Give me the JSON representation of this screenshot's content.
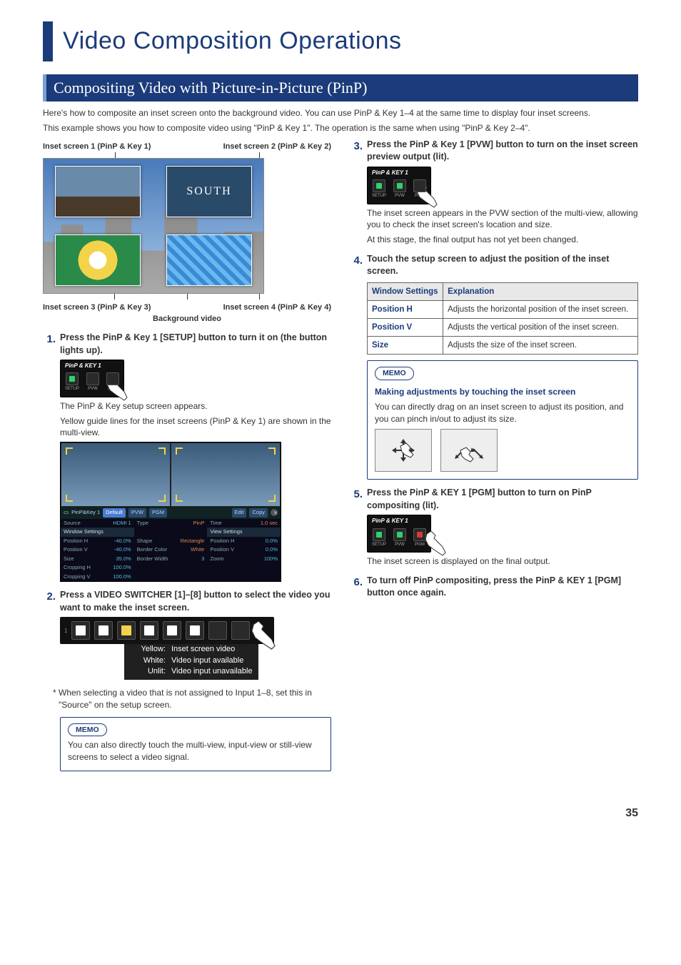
{
  "chapter_title": "Video Composition Operations",
  "section_title": "Compositing Video with Picture-in-Picture (PinP)",
  "intro": {
    "l1": "Here's how to composite an inset screen onto the background video. You can use PinP & Key 1–4 at the same time to display four inset screens.",
    "l2": "This example shows you how to composite video using \"PinP & Key 1\". The operation is the same when using \"PinP & Key 2–4\"."
  },
  "fig_labels": {
    "tl": "Inset screen 1 (PinP & Key 1)",
    "tr": "Inset screen 2 (PinP & Key 2)",
    "bl": "Inset screen 3 (PinP & Key 3)",
    "br": "Inset screen 4 (PinP & Key 4)",
    "bg": "Background video",
    "south": "SOUTH"
  },
  "steps": {
    "s1": {
      "num": "1.",
      "text": "Press the PinP & Key 1 [SETUP] button to turn it on (the button lights up).",
      "after": "The PinP & Key setup screen appears.",
      "after2": "Yellow guide lines for the inset screens (PinP & Key 1) are shown in the multi-view."
    },
    "s2": {
      "num": "2.",
      "text": "Press a VIDEO SWITCHER [1]–[8] button to select the video you want to make the inset screen.",
      "legend": {
        "yellow_k": "Yellow:",
        "yellow_v": "Inset screen video",
        "white_k": "White:",
        "white_v": "Video input available",
        "unlit_k": "Unlit:",
        "unlit_v": "Video input unavailable"
      },
      "footnote": "*  When selecting a video that is not assigned to Input 1–8, set this in \"Source\" on the setup screen."
    },
    "memo1": {
      "pill": "MEMO",
      "body": "You can also directly touch the multi-view, input-view or still-view screens to select a video signal."
    },
    "s3": {
      "num": "3.",
      "text": "Press the PinP & Key 1 [PVW] button to turn on the inset screen preview output (lit).",
      "after": "The inset screen appears in the PVW section of the multi-view, allowing you to check the inset screen's location and size.",
      "after2": "At this stage, the final output has not yet been changed."
    },
    "s4": {
      "num": "4.",
      "text": "Touch the setup screen to adjust the position of the inset screen."
    },
    "memo2": {
      "pill": "MEMO",
      "title": "Making adjustments by touching the inset screen",
      "body": "You can directly drag on an inset screen to adjust its position, and you can pinch in/out to adjust its size."
    },
    "s5": {
      "num": "5.",
      "text": "Press the PinP & KEY 1 [PGM] button to turn on PinP compositing (lit).",
      "after": "The inset screen is displayed on the final output."
    },
    "s6": {
      "num": "6.",
      "text": "To turn off PinP compositing, press the PinP & KEY 1 [PGM] button once again."
    }
  },
  "panel": {
    "title": "PinP & KEY 1",
    "l1": "SETUP",
    "l2": "PVW",
    "l3": "PGM"
  },
  "setup_screen": {
    "name": "PinP&Key 1",
    "default": "Default",
    "pvw": "PVW",
    "pgm": "PGM",
    "edit": "Edit",
    "copy": "Copy",
    "rows_left": [
      {
        "k": "Source",
        "v": "HDMI 1"
      },
      {
        "k": "Window Settings",
        "v": ""
      },
      {
        "k": "Position H",
        "v": "-40.0%"
      },
      {
        "k": "Position V",
        "v": "-40.0%"
      },
      {
        "k": "Size",
        "v": "35.0%"
      },
      {
        "k": "Cropping H",
        "v": "100.0%"
      },
      {
        "k": "Cropping V",
        "v": "100.0%"
      }
    ],
    "rows_mid": [
      {
        "k": "Type",
        "v": "PinP"
      },
      {
        "k": "",
        "v": ""
      },
      {
        "k": "Shape",
        "v": "Rectangle"
      },
      {
        "k": "Border Color",
        "v": "White"
      },
      {
        "k": "Border Width",
        "v": "3"
      }
    ],
    "rows_right": [
      {
        "k": "Time",
        "v": "1.0 sec"
      },
      {
        "k": "View Settings",
        "v": ""
      },
      {
        "k": "Position H",
        "v": "0.0%"
      },
      {
        "k": "Position V",
        "v": "0.0%"
      },
      {
        "k": "Zoom",
        "v": "100%"
      }
    ]
  },
  "table": {
    "h1": "Window Settings",
    "h2": "Explanation",
    "rows": [
      {
        "k": "Position H",
        "v": "Adjusts the horizontal position of the inset screen."
      },
      {
        "k": "Position V",
        "v": "Adjusts the vertical position of the inset screen."
      },
      {
        "k": "Size",
        "v": "Adjusts the size of the inset screen."
      }
    ]
  },
  "page_num": "35"
}
